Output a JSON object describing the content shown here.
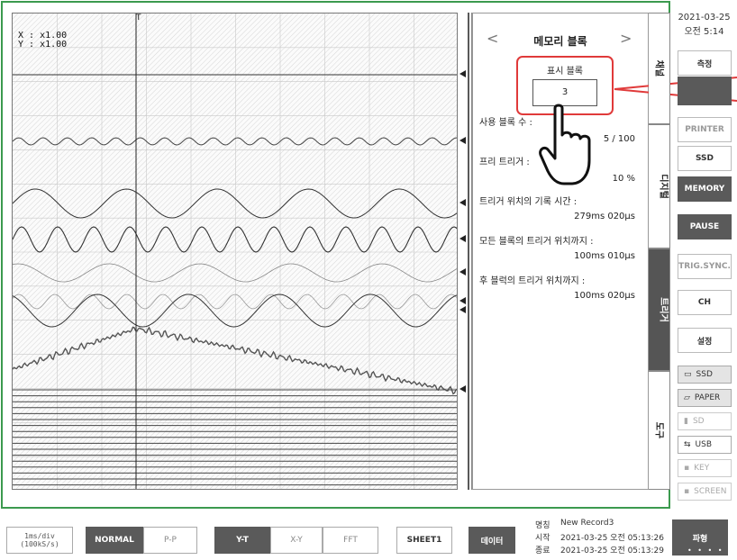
{
  "scale": {
    "x": "X : x1.00",
    "y": "Y : x1.00"
  },
  "trigger_marker": "T",
  "panel": {
    "title": "메모리 블록",
    "display_block_label": "표시 블록",
    "display_block_value": "3",
    "used_blocks_label": "사용 블록 수 :",
    "used_blocks_value": "5 / 100",
    "pretrigger_label": "프리 트리거 :",
    "pretrigger_value": "10 %",
    "trigger_record_time_label": "트리거 위치의 기록 시간 :",
    "trigger_record_time_value": "279ms 020µs",
    "all_blocks_label": "모든 블록의 트리거 위치까지 :",
    "all_blocks_value": "100ms 010µs",
    "next_block_label": "후 블럭의 트리거 위치까지 :",
    "next_block_value": "100ms 020µs"
  },
  "side_tabs": [
    "채널",
    "디지털",
    "트리거",
    "도구"
  ],
  "datetime": {
    "date": "2021-03-25",
    "time": "오전 5:14"
  },
  "right_buttons": {
    "measure": "측정",
    "printer": "PRINTER",
    "ssd": "SSD",
    "memory": "MEMORY",
    "pause": "PAUSE",
    "trig_sync": "TRIG.SYNC.",
    "ch": "CH",
    "settings": "설정"
  },
  "storage_buttons": {
    "ssd": "SSD",
    "paper": "PAPER",
    "sd": "SD",
    "usb": "USB",
    "key": "KEY",
    "screen": "SCREEN"
  },
  "bottom": {
    "timebase_line1": "1ms/div",
    "timebase_line2": "(100kS/s)",
    "normal": "NORMAL",
    "pp": "P-P",
    "yt": "Y-T",
    "xy": "X-Y",
    "fft": "FFT",
    "sheet": "SHEET1",
    "data": "데이터",
    "name_label": "명칭",
    "name_value": "New Record3",
    "start_label": "시작",
    "start_value": "2021-03-25 오전 05:13:26",
    "end_label": "종료",
    "end_value": "2021-03-25 오전 05:13:29",
    "waveform": "파형"
  },
  "colors": {
    "frame": "#3c9a4f",
    "highlight": "#e03a3a",
    "dark_button": "#5a5a5a",
    "trace": "#333333"
  }
}
